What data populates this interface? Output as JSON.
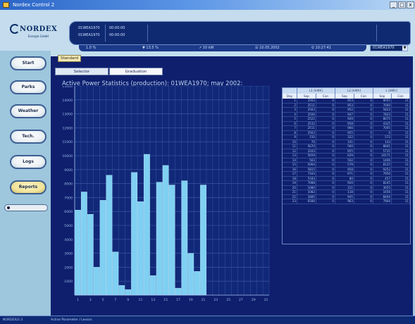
{
  "window": {
    "title": "Nordex Control 2",
    "controls": [
      "_",
      "□",
      "x"
    ]
  },
  "header": {
    "logo_text": "NORDEX",
    "logo_tagline": "Energie GmbH",
    "status_rows": [
      {
        "id": "01WEA1970",
        "value": "00:00:00"
      },
      {
        "id": "01WEA1970",
        "value": "00:00:00"
      }
    ],
    "info_items": [
      "1.0 %",
      "▼ 13.5 %",
      "↗ 10 kW",
      "☰ 10.05.2002",
      "⏲ 10:27:41"
    ],
    "dropdown_value": "01WEA1970"
  },
  "sidebar": {
    "items": [
      {
        "label": "Start"
      },
      {
        "label": "Parks"
      },
      {
        "label": "Weather"
      },
      {
        "label": "Tech."
      },
      {
        "label": "Logs"
      },
      {
        "label": "Reports",
        "active": true
      }
    ]
  },
  "main": {
    "module_tab": "Standard",
    "subtabs": [
      "Selector",
      "Graduation"
    ],
    "chart_title": "Active Power Statistics (production): 01WEA1970; may 2002:"
  },
  "chart_data": {
    "type": "bar",
    "title": "Active Power Statistics (production): 01WEA1970; may 2002:",
    "xlabel": "",
    "ylabel": "",
    "ylim": [
      0,
      15000
    ],
    "y_ticks": [
      "1000",
      "2000",
      "3000",
      "4000",
      "5000",
      "6000",
      "7000",
      "8000",
      "9000",
      "10000",
      "11000",
      "12000",
      "13000",
      "14000",
      "15000"
    ],
    "x_ticks": [
      "1",
      "3",
      "5",
      "7",
      "9",
      "11",
      "13",
      "15",
      "17",
      "19",
      "21",
      "23",
      "25",
      "27",
      "29",
      "31"
    ],
    "categories": [
      "1",
      "2",
      "3",
      "4",
      "5",
      "6",
      "7",
      "8",
      "9",
      "10",
      "11",
      "12",
      "13",
      "14",
      "15",
      "16",
      "17",
      "18",
      "19",
      "20",
      "21",
      "22",
      "23",
      "24",
      "25",
      "26",
      "27",
      "28",
      "29",
      "30",
      "31"
    ],
    "values": [
      6100,
      7400,
      5800,
      2000,
      6800,
      8600,
      3100,
      700,
      400,
      8800,
      6700,
      10100,
      1400,
      8100,
      9300,
      7900,
      500,
      8200,
      3000,
      1700,
      7900,
      0,
      0,
      0,
      0,
      0,
      0,
      0,
      0,
      0,
      0
    ],
    "grid": true
  },
  "table": {
    "group_headers": [
      "L1 [kWh]",
      "L2 [kWh]",
      "L [kWh]"
    ],
    "sub_headers": [
      "Day",
      "Sep",
      "Con",
      "Sep",
      "Con",
      "Sep",
      "Con"
    ],
    "rows": [
      [
        "1",
        "2563",
        "0",
        "953",
        "0",
        "9055",
        "11"
      ],
      [
        "2",
        "2511",
        "0",
        "953",
        "0",
        "7000",
        "11"
      ],
      [
        "3",
        "2563",
        "0",
        "952",
        "0",
        "5833",
        "11"
      ],
      [
        "4",
        "2500",
        "0",
        "947",
        "0",
        "7823",
        "11"
      ],
      [
        "5",
        "2522",
        "0",
        "929",
        "0",
        "8075",
        "11"
      ],
      [
        "6",
        "2532",
        "0",
        "958",
        "0",
        "4325",
        "11"
      ],
      [
        "7",
        "2511",
        "0",
        "966",
        "0",
        "7005",
        "11"
      ],
      [
        "8",
        "2563",
        "0",
        "955",
        "0",
        "0",
        "11"
      ],
      [
        "9",
        "150",
        "0",
        "322",
        "0",
        "572",
        "11"
      ],
      [
        "10",
        "70",
        "0",
        "101",
        "0",
        "143",
        "11"
      ],
      [
        "11",
        "5670",
        "0",
        "560",
        "0",
        "8841",
        "11"
      ],
      [
        "12",
        "3163",
        "0",
        "955",
        "0",
        "5735",
        "11"
      ],
      [
        "13",
        "5659",
        "0",
        "629",
        "0",
        "10171",
        "11"
      ],
      [
        "14",
        "563",
        "0",
        "502",
        "0",
        "1406",
        "11"
      ],
      [
        "15",
        "5064",
        "0",
        "579",
        "0",
        "8125",
        "11"
      ],
      [
        "16",
        "5815",
        "0",
        "958",
        "0",
        "9252",
        "11"
      ],
      [
        "17",
        "7163",
        "0",
        "971",
        "0",
        "7956",
        "11"
      ],
      [
        "18",
        "5183",
        "0",
        "80",
        "0",
        "457",
        "11"
      ],
      [
        "19",
        "7088",
        "0",
        "920",
        "0",
        "8245",
        "11"
      ],
      [
        "20",
        "1080",
        "0",
        "311",
        "0",
        "3055",
        "11"
      ],
      [
        "21",
        "1082",
        "0",
        "118",
        "0",
        "1656",
        "11"
      ],
      [
        "22",
        "1885",
        "0",
        "945",
        "0",
        "8494",
        "11"
      ],
      [
        "23",
        "6580",
        "0",
        "963",
        "0",
        "7904",
        "11"
      ]
    ]
  },
  "statusbar": {
    "left": "NORDEX/2.3",
    "message": "Active Parameter / Lesson"
  }
}
